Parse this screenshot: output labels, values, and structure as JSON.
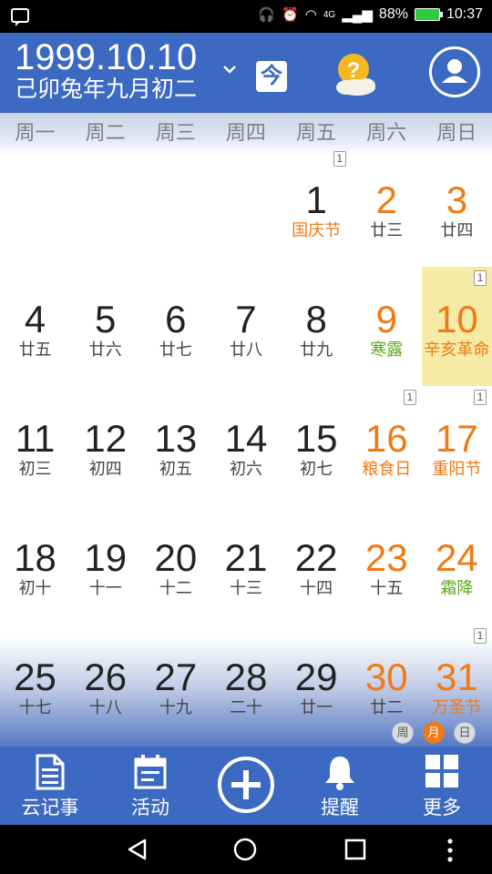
{
  "status_bar": {
    "network": "4G",
    "battery_percent": "88%",
    "time": "10:37"
  },
  "header": {
    "date": "1999.10.10",
    "lunar_date": "己卯兔年九月初二",
    "today_button": "今"
  },
  "weekdays": [
    "周一",
    "周二",
    "周三",
    "周四",
    "周五",
    "周六",
    "周日"
  ],
  "calendar": {
    "selected_day": "10",
    "weeks": [
      [
        null,
        null,
        null,
        null,
        {
          "day": "1",
          "lunar": "国庆节",
          "lunar_style": "orange",
          "badge": "1"
        },
        {
          "day": "2",
          "lunar": "廿三",
          "weekend": true
        },
        {
          "day": "3",
          "lunar": "廿四",
          "weekend": true
        }
      ],
      [
        {
          "day": "4",
          "lunar": "廿五"
        },
        {
          "day": "5",
          "lunar": "廿六"
        },
        {
          "day": "6",
          "lunar": "廿七"
        },
        {
          "day": "7",
          "lunar": "廿八"
        },
        {
          "day": "8",
          "lunar": "廿九"
        },
        {
          "day": "9",
          "lunar": "寒露",
          "lunar_style": "green",
          "weekend": true
        },
        {
          "day": "10",
          "lunar": "辛亥革命",
          "lunar_style": "orange",
          "weekend": true,
          "badge": "1",
          "selected": true
        }
      ],
      [
        {
          "day": "11",
          "lunar": "初三"
        },
        {
          "day": "12",
          "lunar": "初四"
        },
        {
          "day": "13",
          "lunar": "初五"
        },
        {
          "day": "14",
          "lunar": "初六"
        },
        {
          "day": "15",
          "lunar": "初七"
        },
        {
          "day": "16",
          "lunar": "粮食日",
          "lunar_style": "orange",
          "weekend": true,
          "badge": "1"
        },
        {
          "day": "17",
          "lunar": "重阳节",
          "lunar_style": "orange",
          "weekend": true,
          "badge": "1"
        }
      ],
      [
        {
          "day": "18",
          "lunar": "初十"
        },
        {
          "day": "19",
          "lunar": "十一"
        },
        {
          "day": "20",
          "lunar": "十二"
        },
        {
          "day": "21",
          "lunar": "十三"
        },
        {
          "day": "22",
          "lunar": "十四"
        },
        {
          "day": "23",
          "lunar": "十五",
          "weekend": true
        },
        {
          "day": "24",
          "lunar": "霜降",
          "lunar_style": "green",
          "weekend": true
        }
      ],
      [
        {
          "day": "25",
          "lunar": "十七"
        },
        {
          "day": "26",
          "lunar": "十八"
        },
        {
          "day": "27",
          "lunar": "十九"
        },
        {
          "day": "28",
          "lunar": "二十"
        },
        {
          "day": "29",
          "lunar": "廿一"
        },
        {
          "day": "30",
          "lunar": "廿二",
          "weekend": true
        },
        {
          "day": "31",
          "lunar": "万圣节",
          "lunar_style": "orange",
          "weekend": true,
          "badge": "1"
        }
      ]
    ]
  },
  "view_toggle": [
    {
      "label": "周",
      "active": false
    },
    {
      "label": "月",
      "active": true
    },
    {
      "label": "日",
      "active": false
    }
  ],
  "toolbar": {
    "notes_label": "云记事",
    "activity_label": "活动",
    "reminder_label": "提醒",
    "more_label": "更多"
  },
  "colors": {
    "brand_blue": "#3c69c2",
    "weekend_orange": "#f07a14",
    "solar_term_green": "#5aa81a",
    "selected_bg": "#f5eaa6"
  }
}
